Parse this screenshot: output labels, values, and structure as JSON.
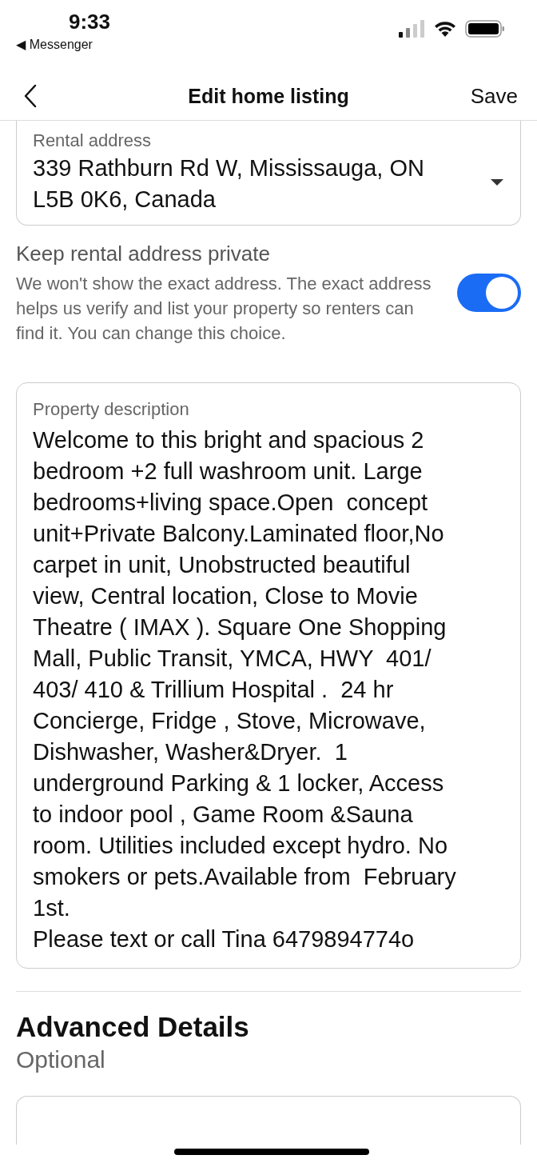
{
  "status_bar": {
    "time": "9:33",
    "back_app": "◀ Messenger"
  },
  "nav": {
    "title": "Edit home listing",
    "action": "Save"
  },
  "rental_address": {
    "label": "Rental address",
    "value": "339 Rathburn Rd W, Mississauga, ON\nL5B 0K6, Canada"
  },
  "keep_private": {
    "title": "Keep rental address private",
    "description": "We won't show the exact address. The exact address helps us verify and list your property so renters can find it. You can change this choice.",
    "on": true
  },
  "property_description": {
    "label": "Property description",
    "value": "Welcome to this bright and spacious 2\nbedroom +2 full washroom unit. Large\nbedrooms+living space.Open  concept\nunit+Private Balcony.Laminated floor,No\ncarpet in unit, Unobstructed beautiful\nview, Central location, Close to Movie\nTheatre ( IMAX ). Square One Shopping\nMall, Public Transit, YMCA, HWY  401/\n403/ 410 & Trillium Hospital .  24 hr\nConcierge, Fridge , Stove, Microwave,\nDishwasher, Washer&Dryer.  1\nunderground Parking & 1 locker, Access\nto indoor pool , Game Room &Sauna\nroom. Utilities included except hydro. No\nsmokers or pets.Available from  February\n1st.\nPlease text or call Tina 6479894774o"
  },
  "advanced": {
    "title": "Advanced Details",
    "subtitle": "Optional"
  }
}
